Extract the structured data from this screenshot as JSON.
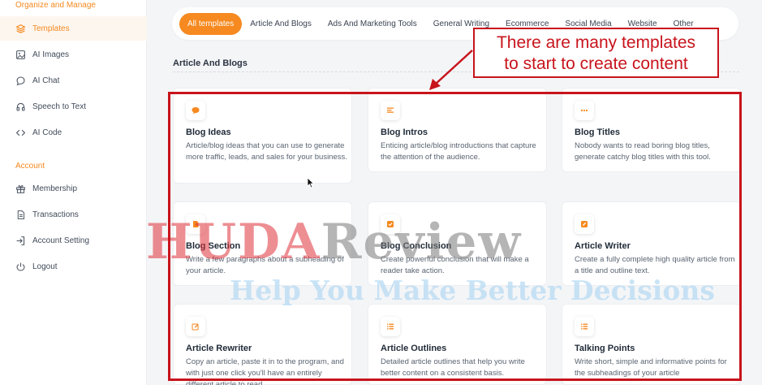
{
  "sidebar": {
    "section1": "Organize and Manage",
    "section2": "Account",
    "items": [
      {
        "label": "Templates",
        "icon": "layers-icon"
      },
      {
        "label": "AI Images",
        "icon": "image-icon"
      },
      {
        "label": "AI Chat",
        "icon": "chat-icon"
      },
      {
        "label": "Speech to Text",
        "icon": "headphones-icon"
      },
      {
        "label": "AI Code",
        "icon": "code-icon"
      },
      {
        "label": "Membership",
        "icon": "gift-icon"
      },
      {
        "label": "Transactions",
        "icon": "document-icon"
      },
      {
        "label": "Account Setting",
        "icon": "signin-icon"
      },
      {
        "label": "Logout",
        "icon": "power-icon"
      }
    ]
  },
  "filters": [
    "All templates",
    "Article And Blogs",
    "Ads And Marketing Tools",
    "General Writing",
    "Ecommerce",
    "Social Media",
    "Website",
    "Other"
  ],
  "section_title": "Article And Blogs",
  "cards": [
    {
      "title": "Blog Ideas",
      "desc": "Article/blog ideas that you can use to generate more traffic, leads, and sales for your business.",
      "icon": "chat-bubble-icon"
    },
    {
      "title": "Blog Intros",
      "desc": "Enticing article/blog introductions that capture the attention of the audience.",
      "icon": "align-left-icon"
    },
    {
      "title": "Blog Titles",
      "desc": "Nobody wants to read boring blog titles, generate catchy blog titles with this tool.",
      "icon": "dots-icon"
    },
    {
      "title": "Blog Section",
      "desc": "Write a few paragraphs about a subheading of your article.",
      "icon": "document-icon"
    },
    {
      "title": "Blog Conclusion",
      "desc": "Create powerful conclusion that will make a reader take action.",
      "icon": "checkbox-icon"
    },
    {
      "title": "Article Writer",
      "desc": "Create a fully complete high quality article from a title and outline text.",
      "icon": "edit-icon"
    },
    {
      "title": "Article Rewriter",
      "desc": "Copy an article, paste it in to the program, and with just one click you'll have an entirely different article to read.",
      "icon": "pencil-square-icon"
    },
    {
      "title": "Article Outlines",
      "desc": "Detailed article outlines that help you write better content on a consistent basis.",
      "icon": "list-icon"
    },
    {
      "title": "Talking Points",
      "desc": "Write short, simple and informative points for the subheadings of your article",
      "icon": "list-icon"
    }
  ],
  "annotation": {
    "line1": "There are many templates",
    "line2": "to start to create content"
  },
  "watermark": {
    "part1": "HUDA",
    "part2": "Review",
    "tagline": "Help You Make Better Decisions"
  },
  "colors": {
    "accent": "#f6891f",
    "annotation_red": "#c8141c"
  }
}
